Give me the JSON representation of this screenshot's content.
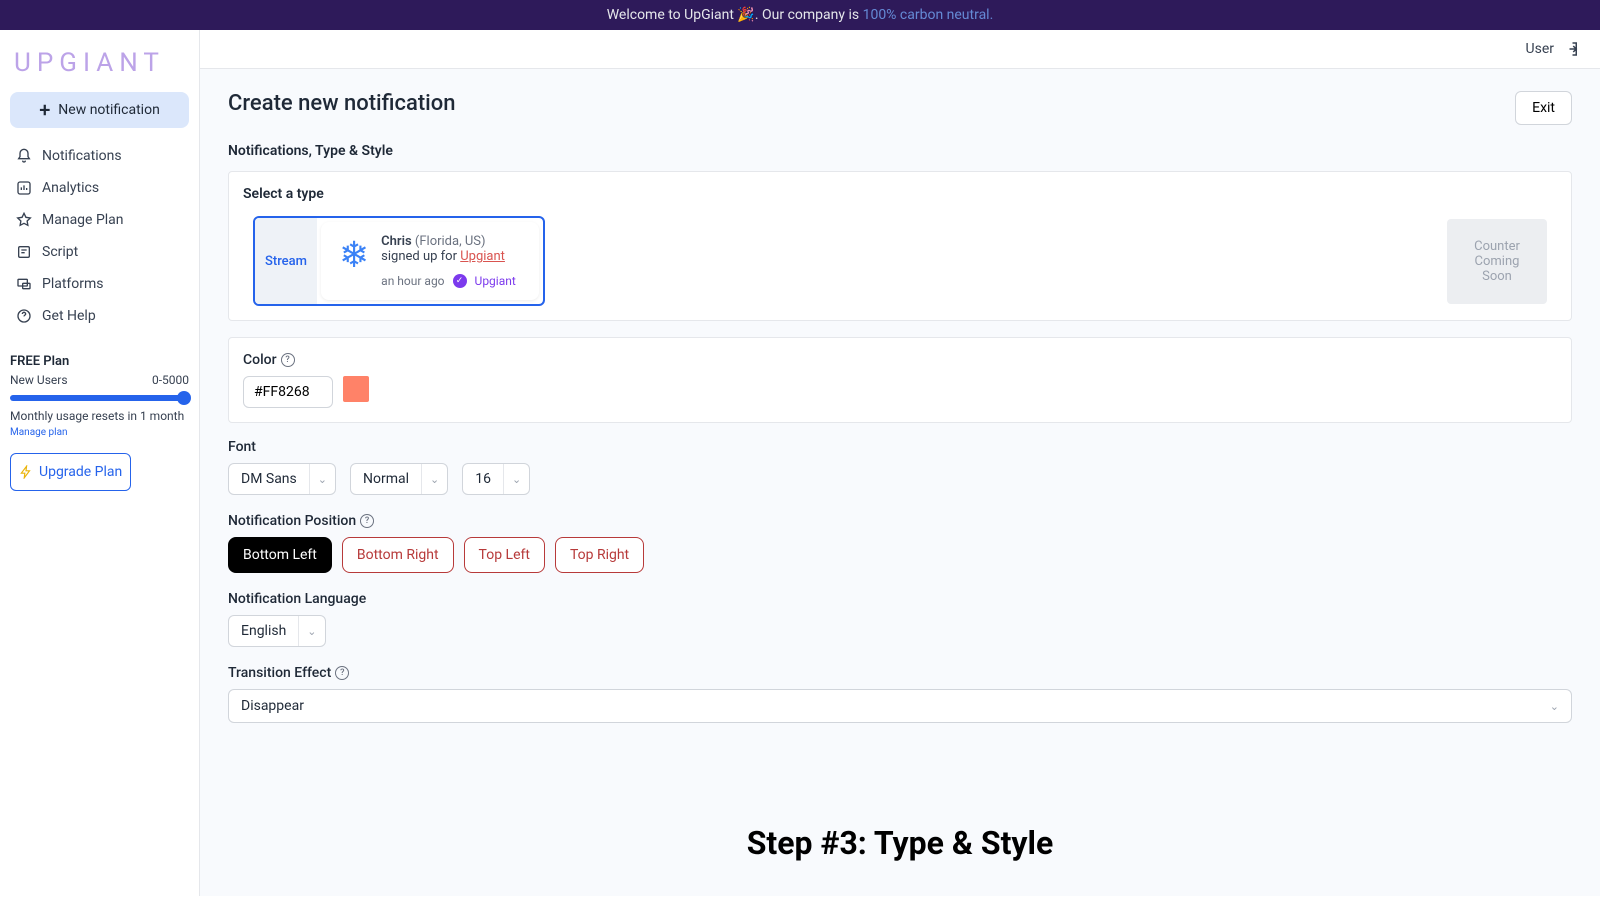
{
  "banner": {
    "welcome": "Welcome to UpGiant 🎉. Our company is ",
    "link": "100% carbon neutral."
  },
  "logo": "UPGIANT",
  "new_notification": "New notification",
  "nav": {
    "notifications": "Notifications",
    "analytics": "Analytics",
    "manage_plan": "Manage Plan",
    "script": "Script",
    "platforms": "Platforms",
    "get_help": "Get Help"
  },
  "plan": {
    "title": "FREE Plan",
    "users_label": "New Users",
    "range": "0-5000",
    "reset_text": "Monthly usage resets in 1 month",
    "manage_link": "Manage plan",
    "upgrade": "Upgrade Plan"
  },
  "header": {
    "user": "User"
  },
  "page": {
    "title": "Create new notification",
    "exit": "Exit",
    "section": "Notifications, Type & Style"
  },
  "type": {
    "label": "Select a type",
    "stream": "Stream",
    "counter_title": "Counter",
    "counter_sub": "Coming Soon"
  },
  "preview": {
    "name": "Chris",
    "location": "(Florida,  US)",
    "action": "signed up for ",
    "product": "Upgiant",
    "time": "an hour ago",
    "brand": "Upgiant"
  },
  "color": {
    "label": "Color",
    "value": "#FF8268"
  },
  "font": {
    "label": "Font",
    "family": "DM Sans",
    "weight": "Normal",
    "size": "16"
  },
  "position": {
    "label": "Notification Position",
    "bl": "Bottom Left",
    "br": "Bottom Right",
    "tl": "Top Left",
    "tr": "Top Right"
  },
  "language": {
    "label": "Notification Language",
    "value": "English"
  },
  "transition": {
    "label": "Transition Effect",
    "value": "Disappear"
  },
  "overlay": "Step #3: Type & Style"
}
